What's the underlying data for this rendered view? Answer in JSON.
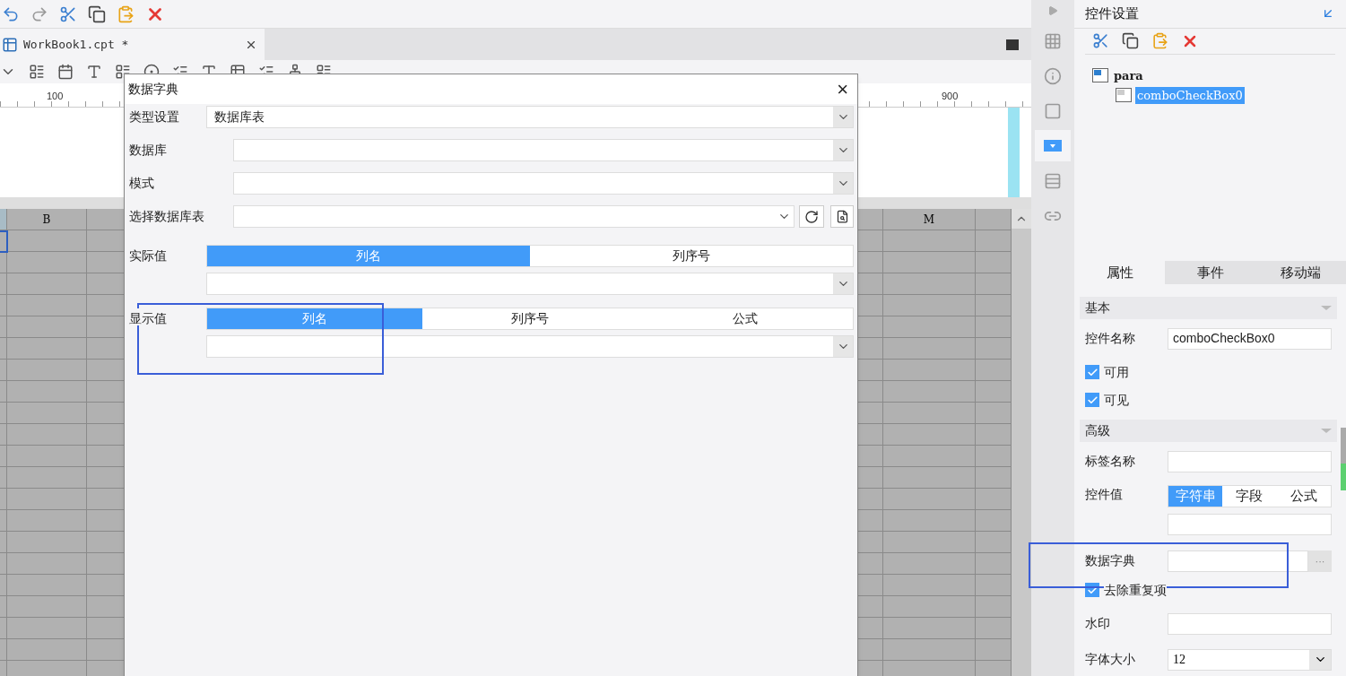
{
  "document_tab": {
    "label": "WorkBook1.cpt *"
  },
  "ruler": {
    "labels": [
      "100",
      "900"
    ]
  },
  "grid": {
    "columns": [
      "B",
      "M"
    ]
  },
  "dialog": {
    "title": "数据字典",
    "close": "×",
    "fields": [
      {
        "kind": "combo",
        "label": "类型设置",
        "value": "数据库表"
      },
      {
        "kind": "select",
        "label": "数据库"
      },
      {
        "kind": "select",
        "label": "模式"
      },
      {
        "kind": "table",
        "label": "选择数据库表"
      },
      {
        "kind": "segmented",
        "label": "实际值",
        "options": [
          {
            "label": "列名",
            "selected": true
          },
          {
            "label": "列序号",
            "selected": false
          }
        ]
      },
      {
        "kind": "segmented",
        "label": "显示值",
        "options": [
          {
            "label": "列名",
            "selected": true
          },
          {
            "label": "列序号",
            "selected": false
          },
          {
            "label": "公式",
            "selected": false
          }
        ]
      }
    ]
  },
  "side_tools": [
    {
      "kind": "grid",
      "selected": false
    },
    {
      "kind": "info",
      "selected": false
    },
    {
      "kind": "frame",
      "selected": false
    },
    {
      "kind": "dropdown",
      "selected": true
    },
    {
      "kind": "rows",
      "selected": false
    },
    {
      "kind": "link",
      "selected": false
    }
  ],
  "panel": {
    "title": "控件设置",
    "tree": [
      {
        "label": "para",
        "selected": false,
        "children": [
          {
            "label": "comboCheckBox0",
            "selected": true
          }
        ]
      }
    ],
    "tabs": [
      {
        "label": "属性",
        "selected": true
      },
      {
        "label": "事件",
        "selected": false
      },
      {
        "label": "移动端",
        "selected": false
      }
    ],
    "properties": [
      {
        "kind": "section",
        "label": "基本"
      },
      {
        "kind": "text",
        "label": "控件名称",
        "value": "comboCheckBox0"
      },
      {
        "kind": "check",
        "label": "可用",
        "checked": true
      },
      {
        "kind": "check",
        "label": "可见",
        "checked": true
      },
      {
        "kind": "section",
        "label": "高级"
      },
      {
        "kind": "text",
        "label": "标签名称"
      },
      {
        "kind": "segmented",
        "label": "控件值",
        "options": [
          {
            "label": "字符串",
            "selected": true
          },
          {
            "label": "字段",
            "selected": false
          },
          {
            "label": "公式",
            "selected": false
          }
        ]
      },
      {
        "kind": "dict",
        "label": "数据字典",
        "button": "···"
      },
      {
        "kind": "check",
        "label": "去除重复项",
        "checked": true
      },
      {
        "kind": "text",
        "label": "水印"
      },
      {
        "kind": "select",
        "label": "字体大小",
        "value": "12"
      }
    ]
  }
}
